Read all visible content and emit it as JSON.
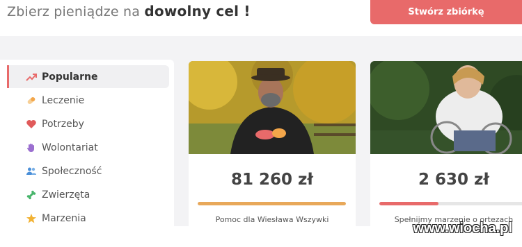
{
  "header": {
    "headline_prefix": "Zbierz pieniądze na",
    "headline_bold": "dowolny cel !",
    "cta_label": "Stwórz zbiórkę"
  },
  "sidebar": {
    "items": [
      {
        "label": "Popularne",
        "icon": "trending-up-icon",
        "color": "#e86a6a",
        "active": true
      },
      {
        "label": "Leczenie",
        "icon": "pill-icon",
        "color": "#f3a64a",
        "active": false
      },
      {
        "label": "Potrzeby",
        "icon": "heart-icon",
        "color": "#e05a5a",
        "active": false
      },
      {
        "label": "Wolontariat",
        "icon": "hand-icon",
        "color": "#9b6fd0",
        "active": false
      },
      {
        "label": "Społeczność",
        "icon": "people-icon",
        "color": "#4a8fd8",
        "active": false
      },
      {
        "label": "Zwierzęta",
        "icon": "bone-icon",
        "color": "#46b46a",
        "active": false
      },
      {
        "label": "Marzenia",
        "icon": "star-icon",
        "color": "#f2b233",
        "active": false
      }
    ]
  },
  "cards": [
    {
      "amount": "81 260 zł",
      "title": "Pomoc dla Wiesława Wszywki",
      "progress": 1.0,
      "progress_color": "#e8a85a"
    },
    {
      "amount": "2 630 zł",
      "title": "Spełnijmy marzenie o ortezach",
      "progress": 0.4,
      "progress_color": "#e86a6a"
    }
  ],
  "watermark": "www.wiocha.pl"
}
